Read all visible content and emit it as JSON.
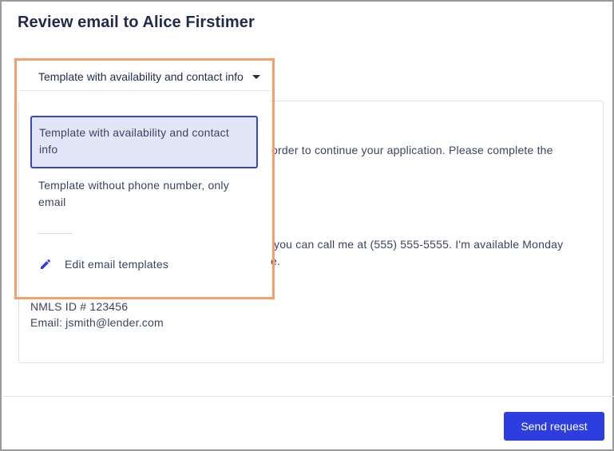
{
  "dialog": {
    "title": "Review email to Alice Firstimer"
  },
  "template_select": {
    "selected_label": "Template with availability and contact info",
    "caret_icon": "caret-down-icon"
  },
  "dropdown": {
    "options": [
      {
        "label": "Template with availability and contact info",
        "selected": true
      },
      {
        "label": "Template without phone number, only email",
        "selected": false
      }
    ],
    "edit_label": "Edit email templates",
    "edit_icon": "pencil-icon"
  },
  "email_body": {
    "line_1": "order to continue your application. Please complete the",
    "line_2": "you can call me at (555) 555-5555. I'm available Monday",
    "line_3": "e.",
    "nmls": "NMLS ID # 123456",
    "email": "Email: jsmith@lender.com"
  },
  "footer": {
    "send_label": "Send request"
  },
  "colors": {
    "primary": "#2c3ee0",
    "highlight": "#f4a06a",
    "selected_bg": "#e3e6f7",
    "selected_border": "#3646c9"
  }
}
